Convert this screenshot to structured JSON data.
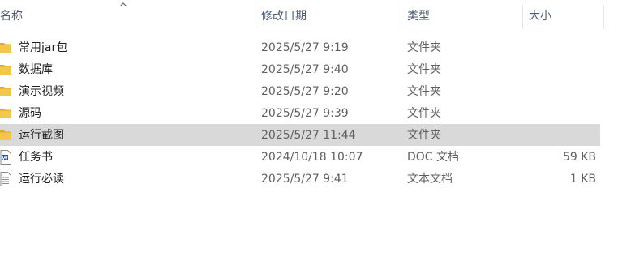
{
  "header": {
    "name": "名称",
    "modified": "修改日期",
    "type": "类型",
    "size": "大小",
    "sort_column": "name",
    "sort_icon": "chevron-up-icon"
  },
  "files": [
    {
      "icon": "folder-icon",
      "name": "常用jar包",
      "modified": "2025/5/27 9:19",
      "type": "文件夹",
      "size": "",
      "selected": false
    },
    {
      "icon": "folder-icon",
      "name": "数据库",
      "modified": "2025/5/27 9:40",
      "type": "文件夹",
      "size": "",
      "selected": false
    },
    {
      "icon": "folder-icon",
      "name": "演示视频",
      "modified": "2025/5/27 9:20",
      "type": "文件夹",
      "size": "",
      "selected": false
    },
    {
      "icon": "folder-icon",
      "name": "源码",
      "modified": "2025/5/27 9:39",
      "type": "文件夹",
      "size": "",
      "selected": false
    },
    {
      "icon": "folder-icon",
      "name": "运行截图",
      "modified": "2025/5/27 11:44",
      "type": "文件夹",
      "size": "",
      "selected": true
    },
    {
      "icon": "word-document-icon",
      "name": "任务书",
      "modified": "2024/10/18 10:07",
      "type": "DOC 文档",
      "size": "59 KB",
      "selected": false
    },
    {
      "icon": "text-document-icon",
      "name": "运行必读",
      "modified": "2025/5/27 9:41",
      "type": "文本文档",
      "size": "1 KB",
      "selected": false
    }
  ],
  "colors": {
    "header_text": "#4c5a74",
    "selected_row": "#d9d9d9",
    "folder": "#f2c84b",
    "folder_dark": "#e0a92a",
    "word_blue": "#2b5797"
  }
}
